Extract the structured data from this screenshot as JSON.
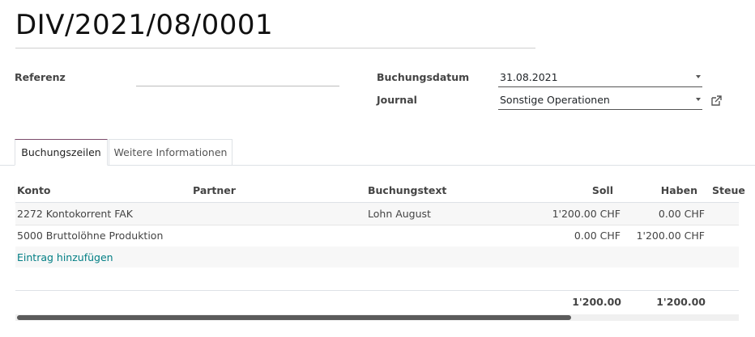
{
  "record": {
    "title": "DIV/2021/08/0001"
  },
  "form": {
    "referenz_label": "Referenz",
    "referenz_value": "",
    "buchungsdatum_label": "Buchungsdatum",
    "buchungsdatum_value": "31.08.2021",
    "journal_label": "Journal",
    "journal_value": "Sonstige Operationen"
  },
  "tabs": [
    {
      "label": "Buchungszeilen",
      "active": true
    },
    {
      "label": "Weitere Informationen",
      "active": false
    }
  ],
  "table": {
    "columns": [
      "Konto",
      "Partner",
      "Buchungstext",
      "Soll",
      "Haben",
      "Steue"
    ],
    "rows": [
      {
        "konto": "2272 Kontokorrent FAK",
        "partner": "",
        "buchungstext": "Lohn August",
        "soll": "1'200.00 CHF",
        "haben": "0.00 CHF"
      },
      {
        "konto": "5000 Bruttolöhne Produktion",
        "partner": "",
        "buchungstext": "",
        "soll": "0.00 CHF",
        "haben": "1'200.00 CHF"
      }
    ],
    "add_line_label": "Eintrag hinzufügen",
    "totals": {
      "soll": "1'200.00",
      "haben": "1'200.00"
    }
  },
  "icons": {
    "external_link": "external-link-icon",
    "dropdown": "caret-down-icon"
  },
  "colors": {
    "accent": "#7c4a6b",
    "link": "#017e84"
  },
  "scrollbar": {
    "visible_fraction": 0.77
  }
}
